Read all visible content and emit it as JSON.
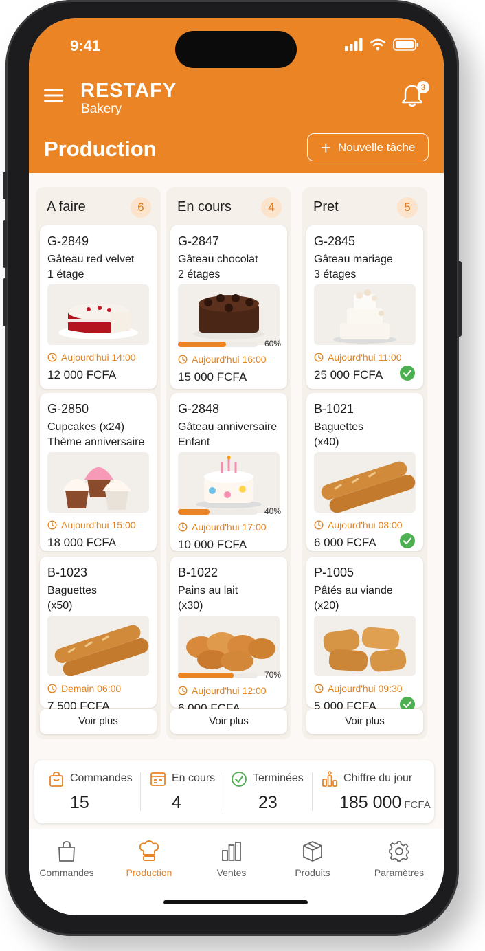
{
  "status_bar": {
    "time": "9:41"
  },
  "header": {
    "brand_name": "RESTAFY",
    "brand_sub": "Bakery",
    "notification_count": "3",
    "page_title": "Production",
    "new_task_label": "Nouvelle tâche"
  },
  "colors": {
    "accent": "#ea8425",
    "success": "#4caf50",
    "badge_bg": "#fbe3cc"
  },
  "columns": [
    {
      "title": "A faire",
      "count": "6",
      "cards": [
        {
          "id": "G-2849",
          "name": "Gâteau red velvet\n1 étage",
          "image": "red-velvet-cake",
          "time": "Aujourd'hui 14:00",
          "price": "12 000 FCFA"
        },
        {
          "id": "G-2850",
          "name": "Cupcakes (x24)\nThème anniversaire",
          "image": "cupcakes",
          "time": "Aujourd'hui 15:00",
          "price": "18 000 FCFA"
        },
        {
          "id": "B-1023",
          "name": "Baguettes\n(x50)",
          "image": "baguettes",
          "time": "Demain 06:00",
          "price": "7 500 FCFA"
        }
      ],
      "more_label": "Voir plus"
    },
    {
      "title": "En cours",
      "count": "4",
      "cards": [
        {
          "id": "G-2847",
          "name": "Gâteau chocolat\n2 étages",
          "image": "chocolate-cake",
          "progress": 0.6,
          "progress_label": "60%",
          "time": "Aujourd'hui 16:00",
          "price": "15 000 FCFA"
        },
        {
          "id": "G-2848",
          "name": "Gâteau anniversaire\nEnfant",
          "image": "birthday-cake",
          "progress": 0.4,
          "progress_label": "40%",
          "time": "Aujourd'hui 17:00",
          "price": "10 000 FCFA"
        },
        {
          "id": "B-1022",
          "name": "Pains au lait\n(x30)",
          "image": "milk-bread",
          "progress": 0.7,
          "progress_label": "70%",
          "time": "Aujourd'hui 12:00",
          "price": "6 000 FCFA"
        }
      ],
      "more_label": "Voir plus"
    },
    {
      "title": "Pret",
      "count": "5",
      "cards": [
        {
          "id": "G-2845",
          "name": "Gâteau mariage\n3 étages",
          "image": "wedding-cake",
          "time": "Aujourd'hui 11:00",
          "price": "25 000 FCFA",
          "done": true
        },
        {
          "id": "B-1021",
          "name": "Baguettes\n(x40)",
          "image": "baguettes",
          "time": "Aujourd'hui 08:00",
          "price": "6 000 FCFA",
          "done": true
        },
        {
          "id": "P-1005",
          "name": "Pâtés au viande\n(x20)",
          "image": "meat-pastries",
          "time": "Aujourd'hui 09:30",
          "price": "5 000 FCFA",
          "done": true
        }
      ],
      "more_label": "Voir plus"
    }
  ],
  "summary": {
    "orders_label": "Commandes",
    "orders_value": "15",
    "in_progress_label": "En cours",
    "in_progress_value": "4",
    "done_label": "Terminées",
    "done_value": "23",
    "revenue_label": "Chiffre du jour",
    "revenue_value": "185 000",
    "revenue_unit": "FCFA"
  },
  "tabs": [
    {
      "label": "Commandes",
      "icon": "shopping-bag-icon"
    },
    {
      "label": "Production",
      "icon": "chef-hat-icon",
      "active": true
    },
    {
      "label": "Ventes",
      "icon": "bar-chart-icon"
    },
    {
      "label": "Produits",
      "icon": "box-icon"
    },
    {
      "label": "Paramètres",
      "icon": "gear-icon"
    }
  ]
}
